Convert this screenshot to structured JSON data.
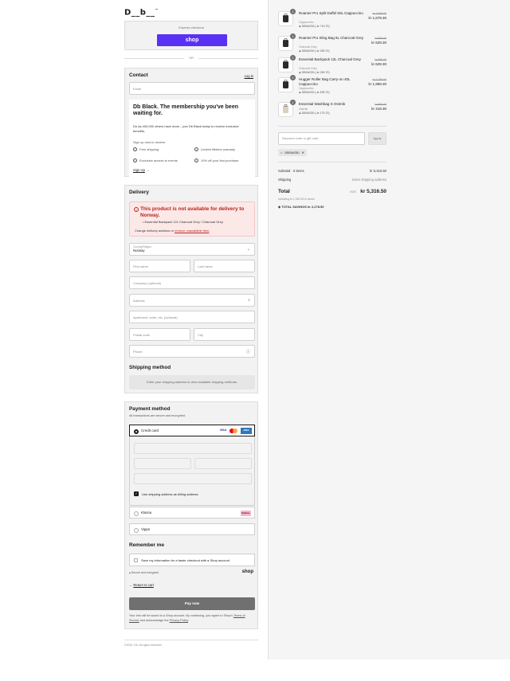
{
  "brand": {
    "logo": "D__b__",
    "tm": "™"
  },
  "express": {
    "label": "Express checkout",
    "shop_button": "shop"
  },
  "or_label": "OR",
  "contact": {
    "title": "Contact",
    "login": "Log in",
    "email_placeholder": "Email",
    "promo": {
      "title": "Db Black. The membership you've been waiting for.",
      "description": "Do as 400,000 others have done – join Db Black today to receive exclusive benefits.",
      "subtitle": "Sign up now to receive",
      "perks": [
        "Free shipping",
        "Limited lifetime warranty",
        "Exclusive access to events",
        "10% off your first purchase"
      ],
      "signup": "Sign Up"
    }
  },
  "delivery": {
    "title": "Delivery",
    "error_title": "This product is not available for delivery to Norway.",
    "error_item": "Essential Backpack 12L Charcoal Grey / Charcoal Grey",
    "error_change_prefix": "Change delivery address or ",
    "error_remove": "remove unavailable item",
    "error_suffix": ".",
    "country_label": "Country/Region",
    "country_value": "Norway",
    "first_name": "First name",
    "last_name": "Last name",
    "company": "Company (optional)",
    "address": "Address",
    "apartment": "Apartment, suite, etc. (optional)",
    "postal": "Postal code",
    "city": "City",
    "phone": "Phone",
    "shipping_title": "Shipping method",
    "shipping_info": "Enter your shipping address to view available shipping methods."
  },
  "payment": {
    "title": "Payment method",
    "subtitle": "All transactions are secure and encrypted.",
    "credit_card": "Credit card",
    "card_brands": [
      "VISA",
      "MC",
      "AMEX"
    ],
    "billing_same": "Use shipping address as billing address",
    "klarna": "Klarna",
    "klarna_badge": "Klarna.",
    "vipps": "Vipps"
  },
  "remember": {
    "title": "Remember me",
    "save_info": "Save my information for a faster checkout with a Shop account",
    "secure": "Secure and encrypted",
    "shop": "shop"
  },
  "return_to_cart": "Return to cart",
  "pay_now": "Pay now",
  "terms": {
    "prefix": "Your info will be saved to a Shop account. By continuing, you agree to Shop's ",
    "tos": "Terms of Service",
    "middle": " and acknowledge the ",
    "privacy": "Privacy Policy",
    "suffix": "."
  },
  "copyright": "©2023, Db. All rights reserved.",
  "cart": {
    "items": [
      {
        "qty": "1",
        "name": "Roamer Pro Split Duffel 50L Cappuccino",
        "variant": "Cappuccino",
        "code": "DBSAS30 (-kr 719.70)",
        "old": "kr 2,399.00",
        "price": "kr 1,679.30"
      },
      {
        "qty": "1",
        "name": "Roamer Pro Sling Bag 6L Charcoal Grey",
        "variant": "Charcoal Grey",
        "code": "DBSAS30 (-kr 269.70)",
        "old": "kr 899.00",
        "price": "kr 629.30"
      },
      {
        "qty": "1",
        "name": "Essential Backpack 12L Charcoal Grey",
        "variant": "Charcoal Grey",
        "code": "DBSAS30 (-kr 269.70)",
        "old": "kr 899.00",
        "price": "kr 629.30"
      },
      {
        "qty": "1",
        "name": "Hugger Roller Bag Carry-on 40L Cappuccino",
        "variant": "Cappuccino",
        "code": "DBSAS30 (-kr 839.70)",
        "old": "kr 2,799.00",
        "price": "kr 1,959.30"
      },
      {
        "qty": "1",
        "name": "Essential Washbag S Ostrnik",
        "variant": "Ostrnik",
        "code": "DBSAS30 (-kr 179.70)",
        "old": "kr 599.00",
        "price": "kr 419.30"
      }
    ],
    "discount_placeholder": "Discount code or gift card",
    "apply": "Apply",
    "applied_code": "DBSAS30",
    "subtotal_label": "Subtotal · 5 items",
    "subtotal": "kr 5,316.50",
    "shipping_label": "Shipping",
    "shipping_value": "Enter shipping address",
    "total_label": "Total",
    "currency": "NOK",
    "total": "kr 5,316.50",
    "taxes": "Including kr 1,063.30 in taxes",
    "savings_label": "TOTAL SAVINGS",
    "savings": "kr 2,278.50"
  },
  "colors": {
    "shop": "#5a31f4",
    "error": "#b3261e",
    "klarna": "#ffb3c7"
  }
}
